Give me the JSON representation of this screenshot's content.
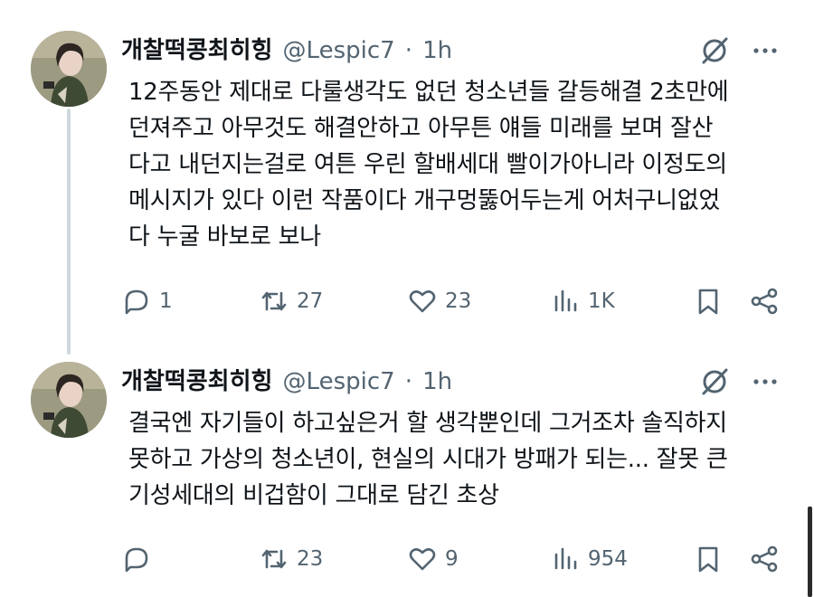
{
  "tweets": [
    {
      "name": "개찰떡콩최히힝",
      "handle": "@Lespic7",
      "dot": "·",
      "time": "1h",
      "text": "12주동안 제대로 다룰생각도 없던 청소년들 갈등해결 2초만에\n던져주고 아무것도 해결안하고 아무튼 얘들 미래를 보며 잘산\n다고 내던지는걸로 여튼 우린 할배세대 빨이가아니라 이정도의\n메시지가 있다 이런 작품이다 개구멍뚫어두는게 어처구니없었\n다 누굴 바보로 보나",
      "replies": "1",
      "retweets": "27",
      "likes": "23",
      "views": "1K"
    },
    {
      "name": "개찰떡콩최히힝",
      "handle": "@Lespic7",
      "dot": "·",
      "time": "1h",
      "text": "결국엔 자기들이 하고싶은거 할 생각뿐인데 그거조차 솔직하지\n못하고 가상의 청소년이, 현실의 시대가 방패가 되는... 잘못 큰\n기성세대의 비겁함이 그대로 담긴 초상",
      "replies": "",
      "retweets": "23",
      "likes": "9",
      "views": "954"
    }
  ],
  "colors": {
    "text": "#0f1419",
    "secondary": "#536471",
    "thread_line": "#cfd9de"
  },
  "icons": [
    "grok-icon",
    "more-icon",
    "reply-icon",
    "retweet-icon",
    "like-icon",
    "views-icon",
    "bookmark-icon",
    "share-icon"
  ]
}
